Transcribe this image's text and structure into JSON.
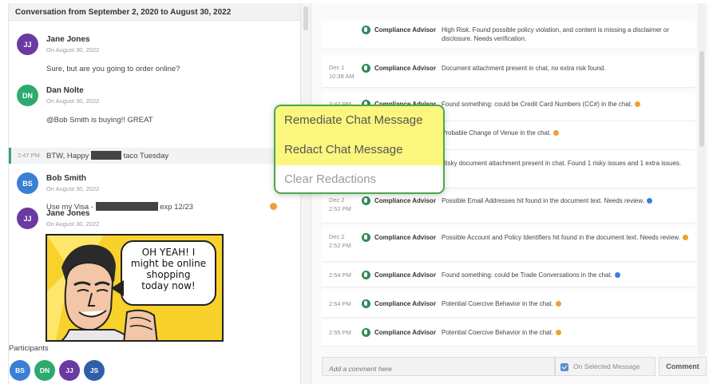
{
  "conversation": {
    "header": "Conversation from September 2, 2020 to August 30, 2022"
  },
  "messages": [
    {
      "initials": "JJ",
      "author": "Jane Jones",
      "date": "On August 30, 2022",
      "text": "Sure, but are you going to order online?"
    },
    {
      "initials": "DN",
      "author": "Dan Nolte",
      "date": "On August 30, 2022",
      "text": "@Bob Smith is buying!! GREAT"
    },
    {
      "time": "2:47 PM",
      "text_before": "BTW, Happy",
      "text_after": "taco Tuesday"
    },
    {
      "initials": "BS",
      "author": "Bob Smith",
      "date": "On August 30, 2022",
      "text_before": "Use my Visa -",
      "text_after": "exp 12/23"
    },
    {
      "initials": "JJ",
      "author": "Jane Jones",
      "date": "On August 30, 2022"
    }
  ],
  "comic": {
    "lines": [
      "OH YEAH! I",
      "might be online",
      "shopping",
      "today now!"
    ]
  },
  "participants": {
    "label": "Participants",
    "list": [
      "BS",
      "DN",
      "JJ",
      "JS"
    ]
  },
  "colors": {
    "avatar_purple": "#6a3aa2",
    "avatar_green": "#2eaa6e",
    "avatar_blue": "#3b7fd4",
    "avatar_navy": "#2f5fa8",
    "compliance_green": "#2e8b57",
    "menu_border": "#49a84c",
    "menu_highlight": "#fbf67d",
    "alert_orange": "#f0a030",
    "alert_blue": "#3b7fd4"
  },
  "alerts": [
    {
      "date": "",
      "time": "",
      "label": "Compliance Advisor",
      "text": "High Risk. Found possible policy violation, and content is missing a disclaimer or disclosure. Needs verification.",
      "dot": ""
    },
    {
      "date": "Dec 1",
      "time": "10:38 AM",
      "label": "Compliance Advisor",
      "text": "Document attachment present in chat, no extra risk found.",
      "dot": ""
    },
    {
      "date": "",
      "time": "2:47 PM",
      "label": "Compliance Advisor",
      "text": "Found something: could be Credit Card Numbers (CC#) in the chat.",
      "dot": "orange"
    },
    {
      "date": "",
      "time": "",
      "label": "",
      "text": "Probable Change of Venue in the chat.",
      "dot": "orange"
    },
    {
      "date": "",
      "time": "",
      "label": "",
      "text": "Risky document attachment present in chat. Found 1 risky issues and 1 extra issues.",
      "dot": ""
    },
    {
      "date": "Dec 2",
      "time": "2:52 PM",
      "label": "Compliance Advisor",
      "text": "Possible Email Addresses hit found in the document text. Needs review.",
      "dot": "blue"
    },
    {
      "date": "Dec 2",
      "time": "2:52 PM",
      "label": "Compliance Advisor",
      "text": "Possible Account and Policy Identifiers hit found in the document text. Needs review.",
      "dot": "orange"
    },
    {
      "date": "",
      "time": "2:54 PM",
      "label": "Compliance Advisor",
      "text": "Found something: could be Trade Conversations in the chat.",
      "dot": "blue"
    },
    {
      "date": "",
      "time": "2:54 PM",
      "label": "Compliance Advisor",
      "text": "Potential Coercive Behavior in the chat.",
      "dot": "orange"
    },
    {
      "date": "",
      "time": "2:55 PM",
      "label": "Compliance Advisor",
      "text": "Potential Coercive Behavior in the chat.",
      "dot": "orange"
    }
  ],
  "comment_bar": {
    "placeholder": "Add a comment here",
    "on_selected_label": "On Selected Message",
    "on_selected_checked": true,
    "button": "Comment"
  },
  "context_menu": {
    "items": [
      "Remediate Chat Message",
      "Redact Chat Message",
      "Clear Redactions"
    ]
  }
}
